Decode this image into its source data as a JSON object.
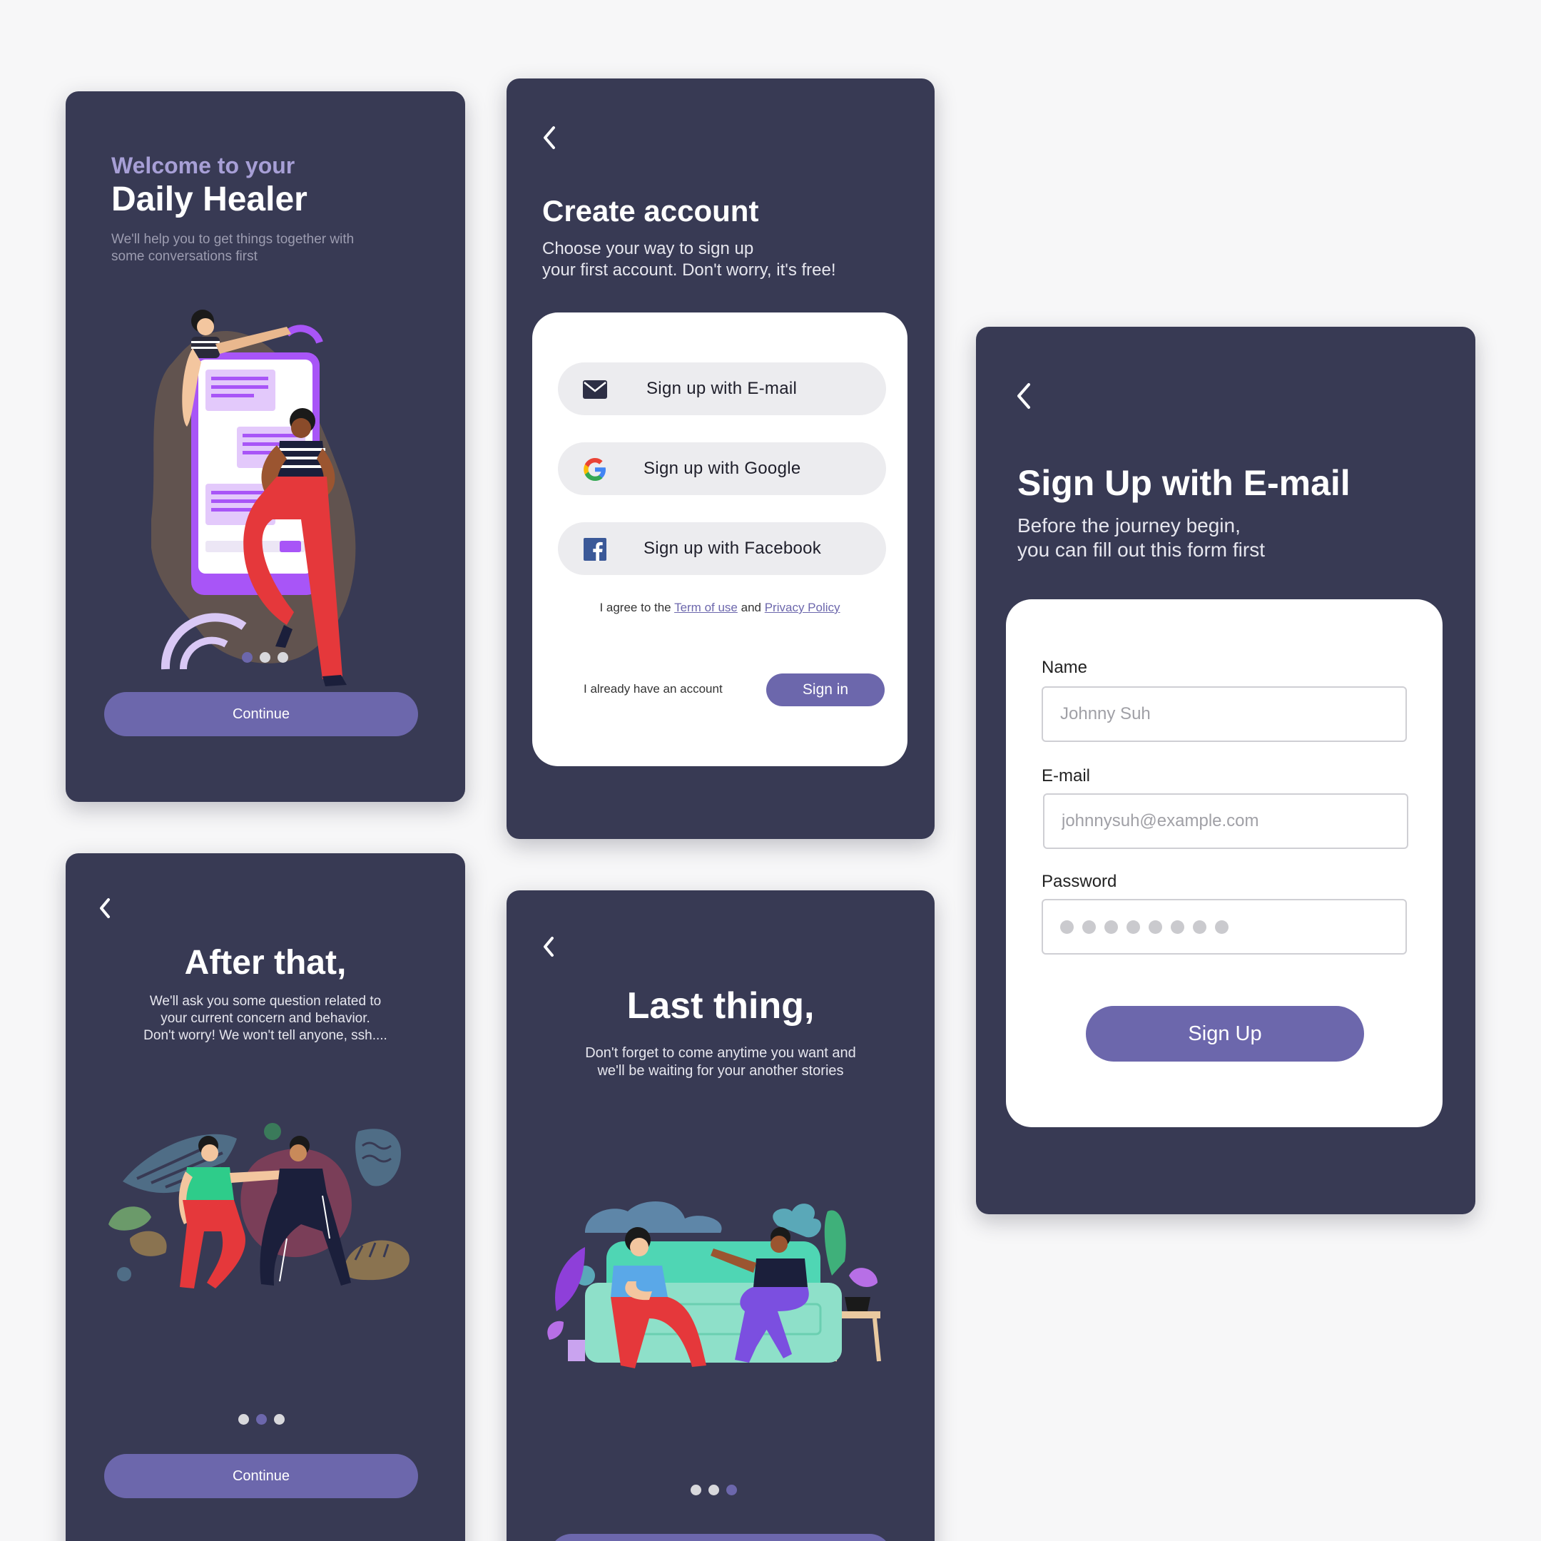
{
  "welcome": {
    "kicker": "Welcome to your",
    "title": "Daily Healer",
    "subtitle_line1": "We'll help you to get things together with",
    "subtitle_line2": "some conversations first",
    "continue_label": "Continue",
    "active_dot": 0
  },
  "create_account": {
    "title": "Create account",
    "subtitle_line1": "Choose your way to sign up",
    "subtitle_line2": "your first account. Don't worry, it's free!",
    "email_button": "Sign up with E-mail",
    "google_button": "Sign up with Google",
    "facebook_button": "Sign up with Facebook",
    "agree_prefix": "I agree to the",
    "terms_link": "Term of use",
    "and_text": "and",
    "privacy_link": "Privacy Policy",
    "have_account": "I already have an account",
    "signin_label": "Sign in"
  },
  "signup_email": {
    "title": "Sign Up with E-mail",
    "subtitle_line1": "Before the journey begin,",
    "subtitle_line2": "you can fill out this form first",
    "name_label": "Name",
    "name_placeholder": "Johnny Suh",
    "email_label": "E-mail",
    "email_placeholder": "johnnysuh@example.com",
    "password_label": "Password",
    "password_dot_count": 8,
    "signup_label": "Sign Up"
  },
  "after_that": {
    "title": "After that,",
    "line1": "We'll ask you some question related to",
    "line2": "your current concern and behavior.",
    "line3": "Don't worry! We won't tell anyone, ssh....",
    "continue_label": "Continue",
    "active_dot": 1
  },
  "last_thing": {
    "title": "Last thing,",
    "line1": "Don't forget to come anytime you want and",
    "line2": "we'll be waiting for your another stories",
    "active_dot": 2
  },
  "colors": {
    "card_bg": "#383a54",
    "accent": "#6c67ac",
    "kicker": "#a79fd6",
    "page_bg": "#f7f7f8"
  },
  "icons": [
    "back-chevron-icon",
    "mail-icon",
    "google-icon",
    "facebook-icon"
  ]
}
